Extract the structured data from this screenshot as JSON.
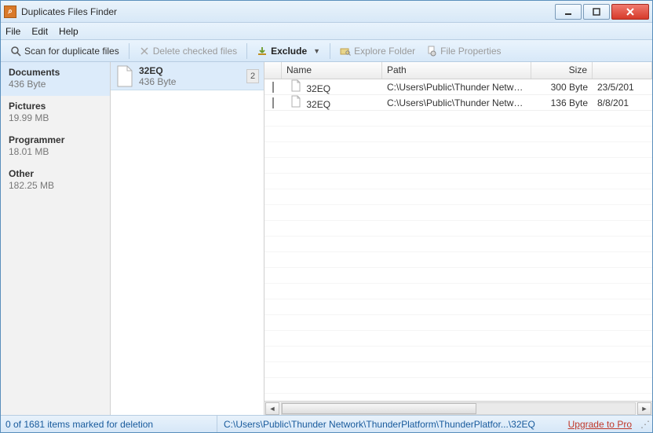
{
  "window": {
    "title": "Duplicates Files Finder"
  },
  "menubar": {
    "file": "File",
    "edit": "Edit",
    "help": "Help"
  },
  "toolbar": {
    "scan": "Scan for duplicate files",
    "delete": "Delete checked files",
    "exclude": "Exclude",
    "explore": "Explore Folder",
    "properties": "File Properties"
  },
  "sidebar": {
    "items": [
      {
        "title": "Documents",
        "sub": "436 Byte",
        "selected": true
      },
      {
        "title": "Pictures",
        "sub": "19.99 MB",
        "selected": false
      },
      {
        "title": "Programmer",
        "sub": "18.01 MB",
        "selected": false
      },
      {
        "title": "Other",
        "sub": "182.25 MB",
        "selected": false
      }
    ]
  },
  "group": {
    "title": "32EQ",
    "sub": "436 Byte",
    "count": "2"
  },
  "grid": {
    "headers": {
      "name": "Name",
      "path": "Path",
      "size": "Size"
    },
    "rows": [
      {
        "name": "32EQ",
        "path": "C:\\Users\\Public\\Thunder Netwo...",
        "size": "300 Byte",
        "date": "23/5/201"
      },
      {
        "name": "32EQ",
        "path": "C:\\Users\\Public\\Thunder Netwo...",
        "size": "136 Byte",
        "date": "8/8/201"
      }
    ]
  },
  "status": {
    "left": "0 of 1681 items marked for deletion",
    "mid": "C:\\Users\\Public\\Thunder Network\\ThunderPlatform\\ThunderPlatfor...\\32EQ",
    "right": "Upgrade to Pro"
  }
}
